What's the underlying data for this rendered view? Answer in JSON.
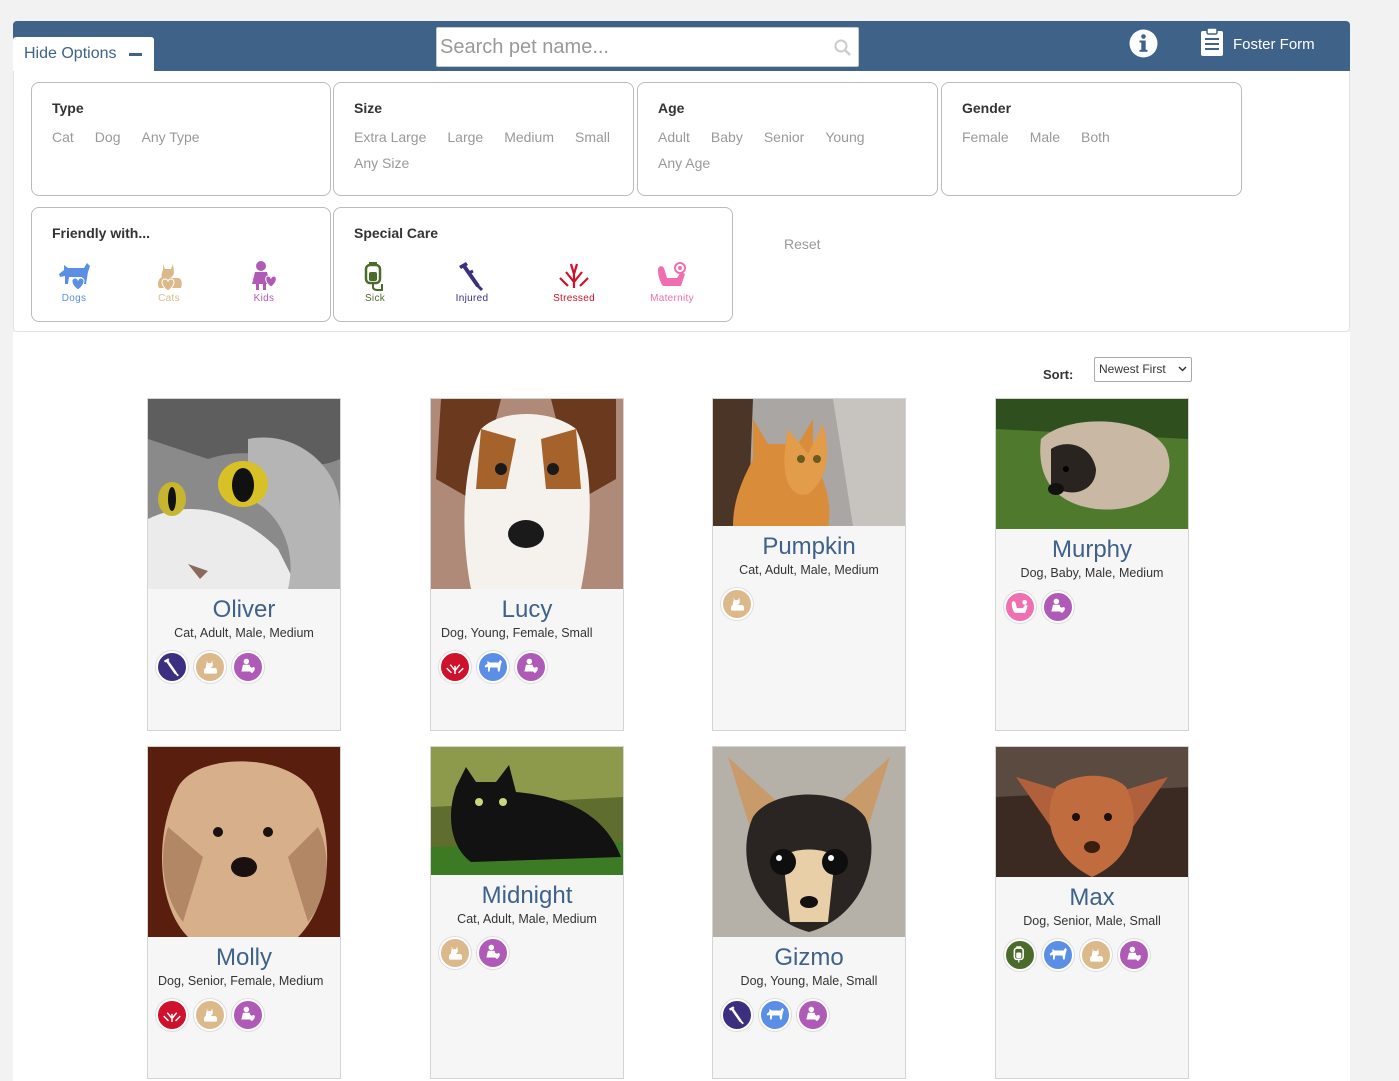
{
  "header": {
    "hide_options_label": "Hide Options",
    "search_placeholder": "Search pet name...",
    "foster_form_label": "Foster Form"
  },
  "filters": {
    "type": {
      "title": "Type",
      "options": [
        "Cat",
        "Dog",
        "Any Type"
      ]
    },
    "size": {
      "title": "Size",
      "options": [
        "Extra Large",
        "Large",
        "Medium",
        "Small",
        "Any Size"
      ]
    },
    "age": {
      "title": "Age",
      "options": [
        "Adult",
        "Baby",
        "Senior",
        "Young",
        "Any Age"
      ]
    },
    "gender": {
      "title": "Gender",
      "options": [
        "Female",
        "Male",
        "Both"
      ]
    },
    "friendly": {
      "title": "Friendly with...",
      "items": [
        {
          "label": "Dogs",
          "icon": "dog-heart-icon",
          "color": "#5b8fe6"
        },
        {
          "label": "Cats",
          "icon": "cat-heart-icon",
          "color": "#dcb98a"
        },
        {
          "label": "Kids",
          "icon": "kid-heart-icon",
          "color": "#b05ab8"
        }
      ]
    },
    "special_care": {
      "title": "Special Care",
      "items": [
        {
          "label": "Sick",
          "icon": "iv-bag-icon",
          "color": "#4a6b2a"
        },
        {
          "label": "Injured",
          "icon": "crutch-icon",
          "color": "#3d2f80"
        },
        {
          "label": "Stressed",
          "icon": "stress-icon",
          "color": "#d0112b"
        },
        {
          "label": "Maternity",
          "icon": "stork-icon",
          "color": "#f06fb0"
        }
      ]
    },
    "reset_label": "Reset"
  },
  "sort": {
    "label": "Sort:",
    "selected": "Newest First"
  },
  "colors": {
    "header_blue": "#3f6289",
    "injured": "#3d2f80",
    "sick": "#4a6b2a",
    "stressed": "#d0112b",
    "maternity": "#f06fb0",
    "dogs": "#5b8fe6",
    "cats": "#dcb98a",
    "kids": "#b05ab8"
  },
  "pets": [
    {
      "name": "Oliver",
      "attrs": "Cat,  Adult,  Male,  Medium",
      "badges": [
        "injured",
        "cats",
        "kids"
      ]
    },
    {
      "name": "Lucy",
      "attrs": "Dog,  Young,  Female,  Small",
      "badges": [
        "stressed",
        "dogs",
        "kids"
      ]
    },
    {
      "name": "Pumpkin",
      "attrs": "Cat,  Adult,  Male,  Medium",
      "badges": [
        "cats"
      ]
    },
    {
      "name": "Murphy",
      "attrs": "Dog,  Baby,  Male,  Medium",
      "badges": [
        "maternity",
        "kids"
      ]
    },
    {
      "name": "Molly",
      "attrs": "Dog,  Senior,  Female,  Medium",
      "badges": [
        "stressed",
        "cats",
        "kids"
      ]
    },
    {
      "name": "Midnight",
      "attrs": "Cat,  Adult,  Male,  Medium",
      "badges": [
        "cats",
        "kids"
      ]
    },
    {
      "name": "Gizmo",
      "attrs": "Dog,  Young,  Male,  Small",
      "badges": [
        "injured",
        "dogs",
        "kids"
      ]
    },
    {
      "name": "Max",
      "attrs": "Dog,  Senior,  Male,  Small",
      "badges": [
        "sick",
        "dogs",
        "cats",
        "kids"
      ]
    }
  ]
}
